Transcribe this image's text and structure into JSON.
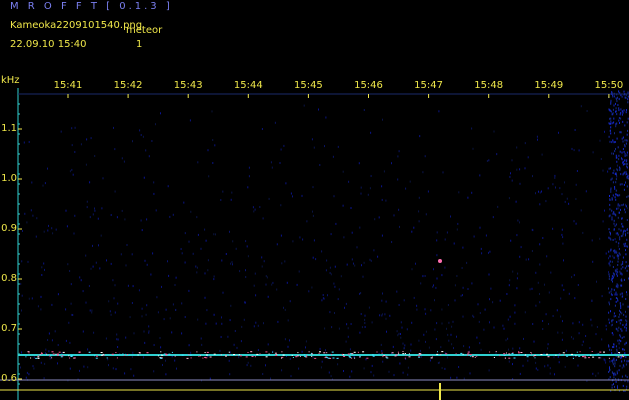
{
  "header": {
    "app_title": "M R O F F T  [ 0.1.3 ]",
    "file_name": "Kameoka2209101540.png",
    "meteor_label": "meteor",
    "timestamp": "22.09.10  15:40",
    "meteor_count": "1"
  },
  "axes": {
    "y_unit": "kHz",
    "x_ticks": [
      "15:41",
      "15:42",
      "15:43",
      "15:44",
      "15:45",
      "15:46",
      "15:47",
      "15:48",
      "15:49",
      "15:50"
    ],
    "y_ticks": [
      "1.1",
      "1.0",
      "0.9",
      "0.8",
      "0.7",
      "0.6"
    ]
  },
  "colors": {
    "label": "#f0e84a",
    "title": "#7a7ff0",
    "axis": "#2fd0d0",
    "carrier": "#ff5fa0",
    "background": "#000000"
  }
}
